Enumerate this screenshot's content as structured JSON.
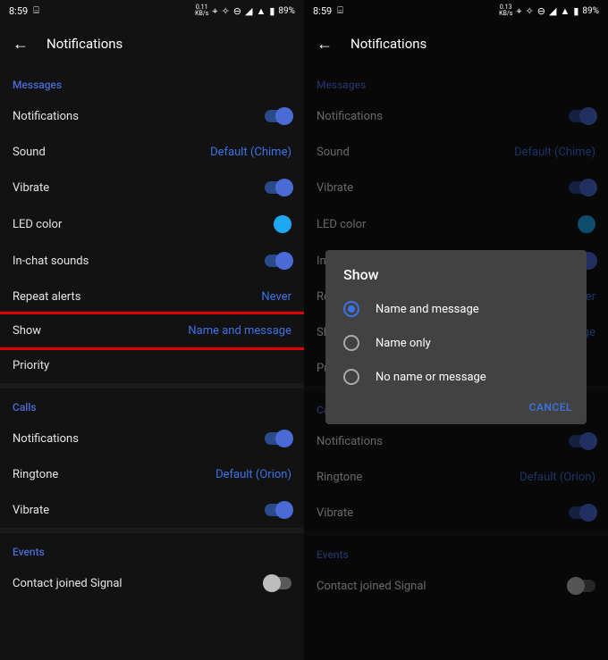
{
  "status": {
    "time": "8:59",
    "net_left": "0.11",
    "net_right": "0.13",
    "net_unit": "KB/s",
    "battery": "89%"
  },
  "appbar": {
    "title": "Notifications"
  },
  "sections": {
    "messages": {
      "header": "Messages",
      "notifications": "Notifications",
      "sound_label": "Sound",
      "sound_value": "Default (Chime)",
      "vibrate": "Vibrate",
      "led": "LED color",
      "inchat": "In-chat sounds",
      "repeat_label": "Repeat alerts",
      "repeat_value": "Never",
      "show_label": "Show",
      "show_value": "Name and message",
      "priority": "Priority"
    },
    "calls": {
      "header": "Calls",
      "notifications": "Notifications",
      "ringtone_label": "Ringtone",
      "ringtone_value": "Default (Orion)",
      "vibrate": "Vibrate"
    },
    "events": {
      "header": "Events",
      "contact_joined": "Contact joined Signal"
    }
  },
  "dialog": {
    "title": "Show",
    "options": [
      "Name and message",
      "Name only",
      "No name or message"
    ],
    "selected": 0,
    "cancel": "CANCEL"
  }
}
